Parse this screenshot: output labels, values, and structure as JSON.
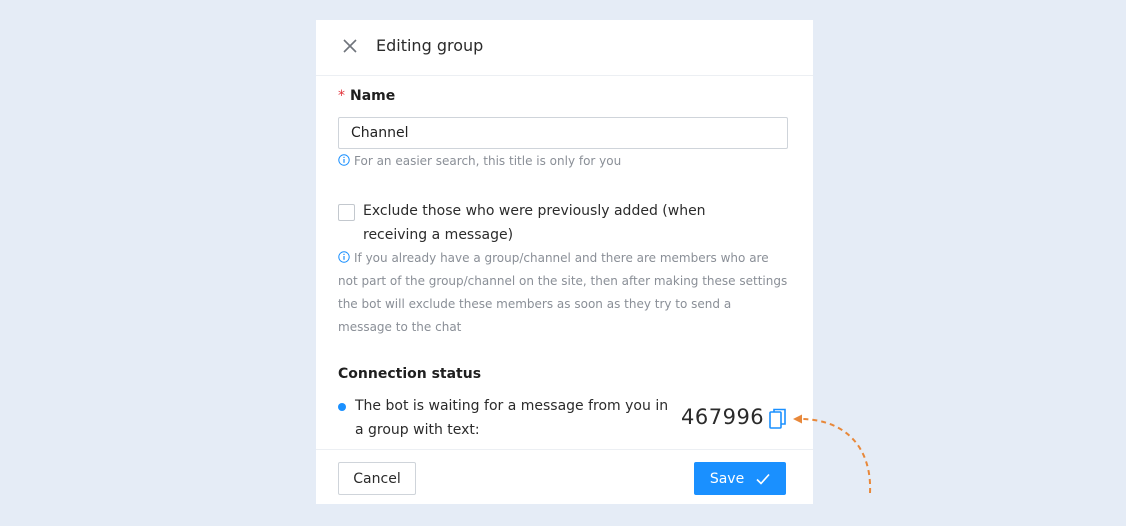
{
  "modal": {
    "title": "Editing group",
    "close_icon": "close-icon"
  },
  "name_field": {
    "required_mark": "*",
    "label": "Name",
    "value": "Channel",
    "placeholder": "",
    "hint": "For an easier search, this title is only for you",
    "hint_icon": "info-icon"
  },
  "exclude_option": {
    "checked": false,
    "label": "Exclude those who were previously added (when receiving a message)",
    "hint": "If you already have a group/channel and there are members who are not part of the group/channel on the site, then after making these settings the bot will exclude these members as soon as they try to send a message to the chat",
    "hint_icon": "info-icon"
  },
  "connection_status": {
    "title": "Connection status",
    "status_text": "The bot is waiting for a message from you in a group with text:",
    "code": "467996",
    "copy_icon": "copy-icon"
  },
  "footer": {
    "cancel_label": "Cancel",
    "save_label": "Save",
    "save_icon": "check-icon"
  },
  "colors": {
    "accent": "#1a90ff",
    "required": "#e2323a",
    "arrow": "#e8883a",
    "background": "#e5ecf6"
  }
}
